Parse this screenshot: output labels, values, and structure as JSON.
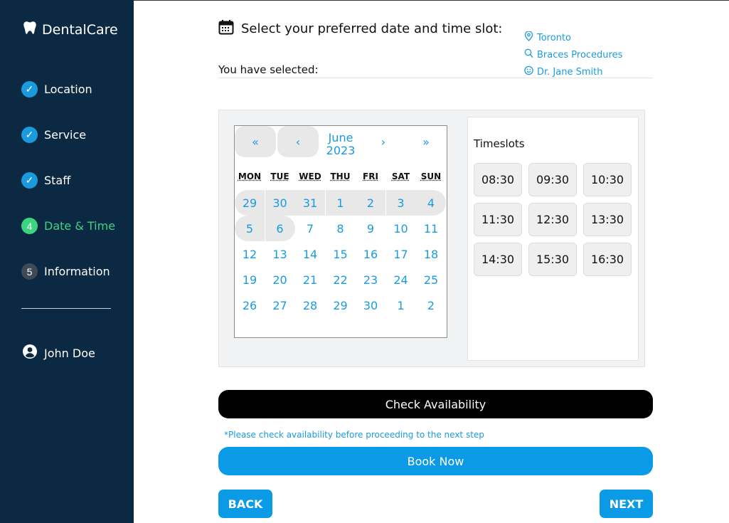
{
  "brand": {
    "name": "DentalCare",
    "icon": "tooth-icon"
  },
  "steps": [
    {
      "label": "Location",
      "badge": "✓",
      "state": "done"
    },
    {
      "label": "Service",
      "badge": "✓",
      "state": "done"
    },
    {
      "label": "Staff",
      "badge": "✓",
      "state": "done"
    },
    {
      "label": "Date & Time",
      "badge": "4",
      "state": "active"
    },
    {
      "label": "Information",
      "badge": "5",
      "state": "pending"
    }
  ],
  "user": {
    "name": "John Doe",
    "icon": "user-circle-icon"
  },
  "header": {
    "title": "Select your preferred date and time slot:",
    "title_icon": "calendar-icon",
    "selected_label": "You have selected:"
  },
  "selection": {
    "location": "Toronto",
    "service": "Braces Procedures",
    "staff": "Dr. Jane Smith"
  },
  "calendar": {
    "prev_year": "«",
    "prev_month": "‹",
    "month": "June",
    "year": "2023",
    "next_month": "›",
    "next_year": "»",
    "weekdays": [
      "MON",
      "TUE",
      "WED",
      "THU",
      "FRI",
      "SAT",
      "SUN"
    ],
    "weeks": [
      [
        "29",
        "30",
        "31",
        "1",
        "2",
        "3",
        "4"
      ],
      [
        "5",
        "6",
        "7",
        "8",
        "9",
        "10",
        "11"
      ],
      [
        "12",
        "13",
        "14",
        "15",
        "16",
        "17",
        "18"
      ],
      [
        "19",
        "20",
        "21",
        "22",
        "23",
        "24",
        "25"
      ],
      [
        "26",
        "27",
        "28",
        "29",
        "30",
        "1",
        "2"
      ]
    ],
    "disabled_through_index": 8
  },
  "timeslots": {
    "title": "Timeslots",
    "slots": [
      "08:30",
      "09:30",
      "10:30",
      "11:30",
      "12:30",
      "13:30",
      "14:30",
      "15:30",
      "16:30"
    ]
  },
  "actions": {
    "check_label": "Check Availability",
    "note": "*Please check availability before proceeding to the next step",
    "book_label": "Book Now",
    "back_label": "BACK",
    "next_label": "NEXT"
  },
  "colors": {
    "sidebar_bg": "#0b2942",
    "accent": "#1a9be0",
    "active_step": "#3bd47f",
    "primary_button": "#0b9be6"
  }
}
